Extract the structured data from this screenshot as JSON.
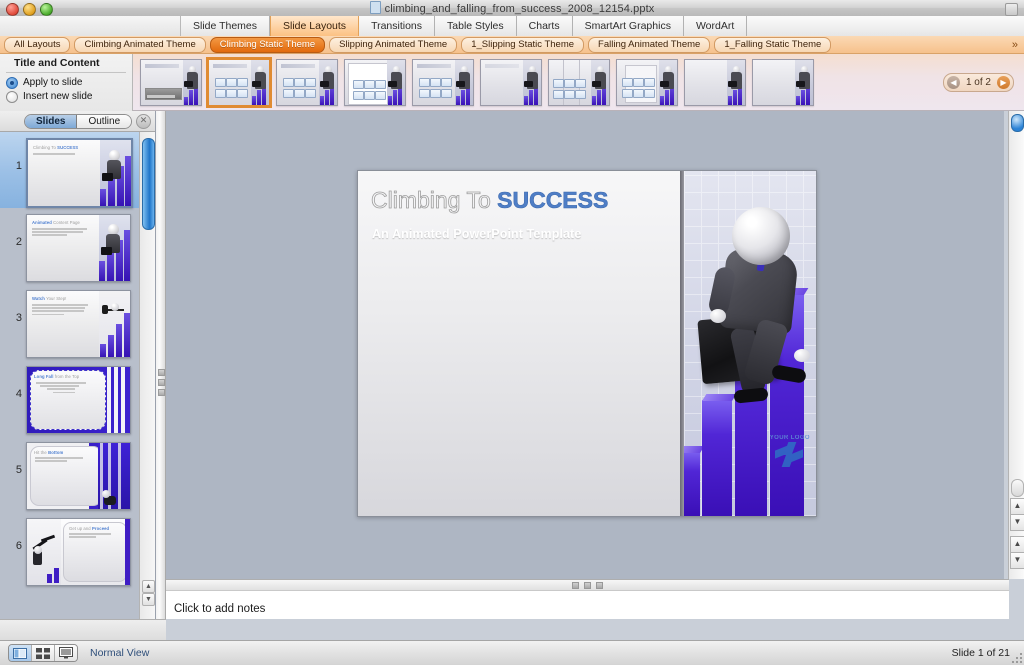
{
  "window": {
    "title": "climbing_and_falling_from_success_2008_12154.pptx",
    "doc_icon": "document-icon",
    "close_label": "",
    "minimize_label": "",
    "maximize_label": ""
  },
  "ribbon": {
    "tabs": [
      {
        "label": "Slide Themes",
        "active": false
      },
      {
        "label": "Slide Layouts",
        "active": true
      },
      {
        "label": "Transitions",
        "active": false
      },
      {
        "label": "Table Styles",
        "active": false
      },
      {
        "label": "Charts",
        "active": false
      },
      {
        "label": "SmartArt Graphics",
        "active": false
      },
      {
        "label": "WordArt",
        "active": false
      }
    ],
    "theme_chips": [
      {
        "label": "All Layouts",
        "active": false
      },
      {
        "label": "Climbing Animated Theme",
        "active": false
      },
      {
        "label": "Climbing Static Theme",
        "active": true
      },
      {
        "label": "Slipping Animated Theme",
        "active": false
      },
      {
        "label": "1_Slipping Static Theme",
        "active": false
      },
      {
        "label": "Falling Animated Theme",
        "active": false
      },
      {
        "label": "1_Falling Static Theme",
        "active": false
      }
    ],
    "chips_overflow": "»"
  },
  "layout_panel": {
    "header": "Title and Content",
    "options": [
      {
        "label": "Apply to slide",
        "selected": true
      },
      {
        "label": "Insert new slide",
        "selected": false
      }
    ]
  },
  "gallery": {
    "pager": {
      "prev": "◀",
      "label": "1 of 2",
      "next": "▶"
    },
    "items": [
      {
        "name": "title-slide-layout",
        "selected": false,
        "kind": "title"
      },
      {
        "name": "title-and-content-layout",
        "selected": true,
        "kind": "content"
      },
      {
        "name": "section-header-layout",
        "selected": false,
        "kind": "content"
      },
      {
        "name": "two-content-layout",
        "selected": false,
        "kind": "whitebox"
      },
      {
        "name": "comparison-layout",
        "selected": false,
        "kind": "content"
      },
      {
        "name": "title-only-layout",
        "selected": false,
        "kind": "blank"
      },
      {
        "name": "blank-layout",
        "selected": false,
        "kind": "split"
      },
      {
        "name": "content-with-caption-layout",
        "selected": false,
        "kind": "caption"
      },
      {
        "name": "picture-with-caption-layout",
        "selected": false,
        "kind": "blank"
      },
      {
        "name": "vertical-title-layout",
        "selected": false,
        "kind": "blank"
      }
    ]
  },
  "sidebar": {
    "tabs": [
      {
        "label": "Slides",
        "active": true
      },
      {
        "label": "Outline",
        "active": false
      }
    ],
    "close_icon": "close-icon",
    "slides": [
      {
        "number": "1",
        "title_gray": "Climbing To ",
        "title_blue": "SUCCESS",
        "selected": true,
        "kind": "title"
      },
      {
        "number": "2",
        "title_blue": "Animated",
        "title_gray": " Content Page",
        "selected": false,
        "kind": "content"
      },
      {
        "number": "3",
        "title_blue": "Watch",
        "title_gray": " Your Step!",
        "selected": false,
        "kind": "content-bars"
      },
      {
        "number": "4",
        "title_blue": "Long Fall",
        "title_gray": " from the Top",
        "selected": false,
        "kind": "rounded"
      },
      {
        "number": "5",
        "title_gray": "Hit the ",
        "title_blue": "Bottom",
        "selected": false,
        "kind": "rounded"
      },
      {
        "number": "6",
        "title_gray": "Get up and ",
        "title_blue": "Proceed",
        "selected": false,
        "kind": "mirrored"
      }
    ]
  },
  "slide": {
    "title_part1": "Climbing To ",
    "title_part2": "SUCCESS",
    "subtitle": "An Animated PowerPoint Template",
    "watermark": "YOUR LOGO"
  },
  "notes": {
    "placeholder": "Click to add notes"
  },
  "status": {
    "view_label": "Normal View",
    "slide_counter": "Slide 1 of 21",
    "view_buttons": [
      {
        "name": "normal-view-button",
        "icon": "normal-view-icon",
        "active": true
      },
      {
        "name": "slide-sorter-button",
        "icon": "slide-sorter-icon",
        "active": false
      },
      {
        "name": "slideshow-button",
        "icon": "slideshow-icon",
        "active": false
      }
    ]
  },
  "scroll": {
    "up_arrow": "▲",
    "down_arrow": "▼",
    "prev_slide": "▲",
    "next_slide": "▼"
  }
}
